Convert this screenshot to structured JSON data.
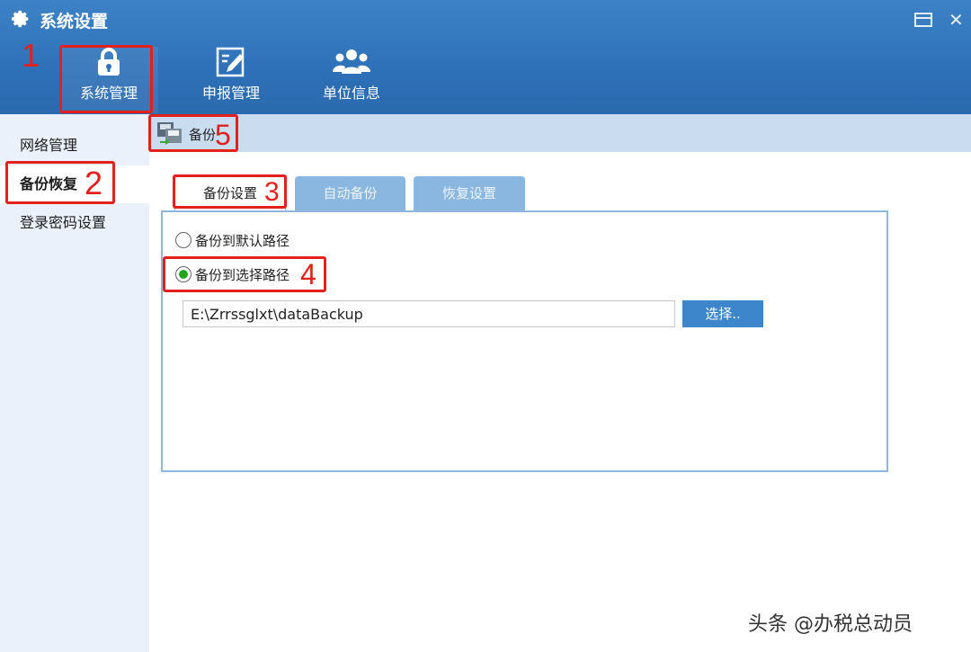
{
  "window": {
    "title": "系统设置",
    "title_icon": "gear-icon",
    "max_icon": "restore-window-icon",
    "close_glyph": "✕"
  },
  "top_nav": [
    {
      "label": "系统管理",
      "icon": "lock-icon"
    },
    {
      "label": "申报管理",
      "icon": "edit-icon"
    },
    {
      "label": "单位信息",
      "icon": "group-icon"
    }
  ],
  "sidebar": {
    "items": [
      {
        "label": "网络管理"
      },
      {
        "label": "备份恢复"
      },
      {
        "label": "登录密码设置"
      }
    ]
  },
  "toolbar": {
    "backup_label": "备份",
    "backup_icon": "backup-icon"
  },
  "tabs": [
    {
      "label": "备份设置"
    },
    {
      "label": "自动备份"
    },
    {
      "label": "恢复设置"
    }
  ],
  "backup": {
    "option_default": "备份到默认路径",
    "option_select": "备份到选择路径",
    "selected": "option_select",
    "path_value": "E:\\Zrrssglxt\\dataBackup",
    "choose_label": "选择.."
  },
  "annotations": {
    "n1": "1",
    "n2": "2",
    "n3": "3",
    "n4": "4",
    "n5": "5",
    "color": "#e3201b"
  },
  "colors": {
    "header": "#2e71b9",
    "sidebar": "#eaf1fa",
    "toolbar": "#c9dcf0",
    "tab_inactive": "#8ab7e0",
    "button": "#3d86cc",
    "radio_checked": "#22a322"
  },
  "watermark": "头条 @办税总动员"
}
